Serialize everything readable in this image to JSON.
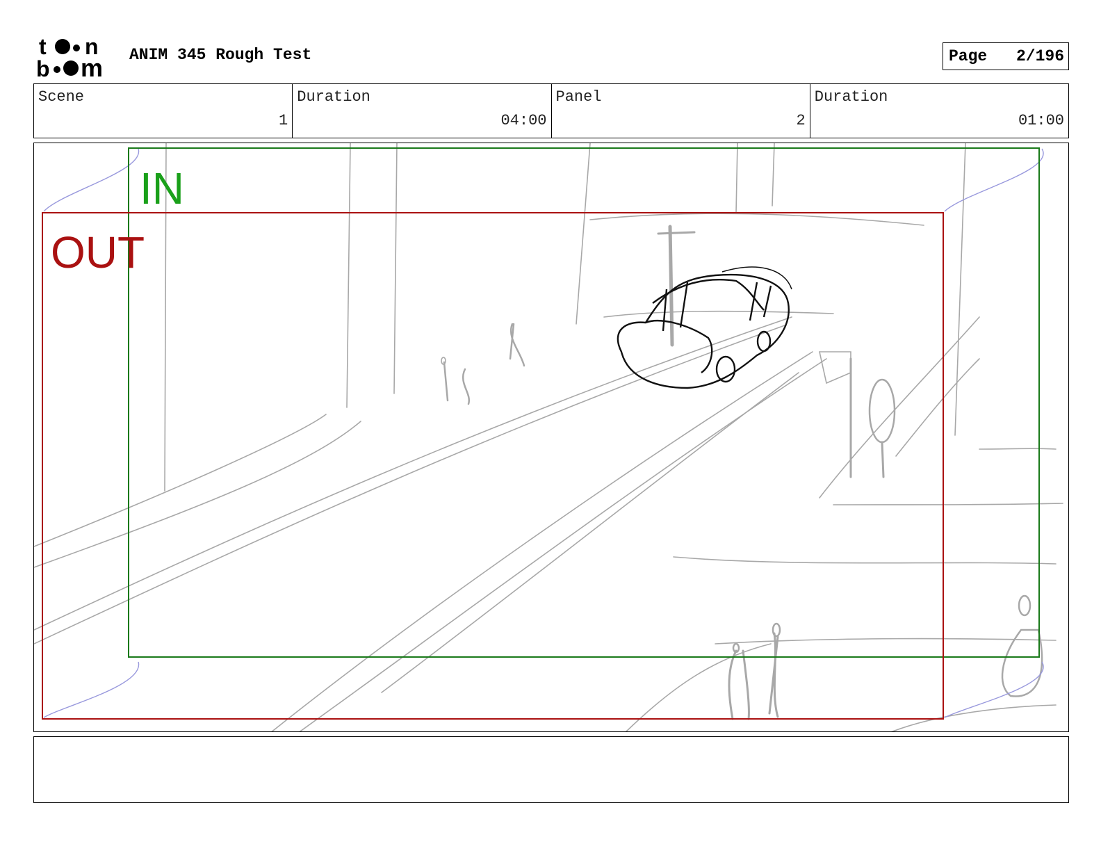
{
  "header": {
    "brand_top": "t",
    "brand_top_tail": "n",
    "brand_bottom": "b",
    "brand_bottom_tail": "m",
    "title": "ANIM 345 Rough Test",
    "page_label": "Page",
    "page_value": "2/196"
  },
  "info": {
    "scene_label": "Scene",
    "scene_value": "1",
    "scene_duration_label": "Duration",
    "scene_duration_value": "04:00",
    "panel_label": "Panel",
    "panel_value": "2",
    "panel_duration_label": "Duration",
    "panel_duration_value": "01:00"
  },
  "panel": {
    "in_label": "IN",
    "out_label": "OUT",
    "colors": {
      "in_frame": "#1a7a1a",
      "out_frame": "#aa1111",
      "sketch": "#a8a8a8",
      "car": "#111111",
      "camera_path": "#9999dd"
    }
  },
  "notes": {
    "text": ""
  }
}
